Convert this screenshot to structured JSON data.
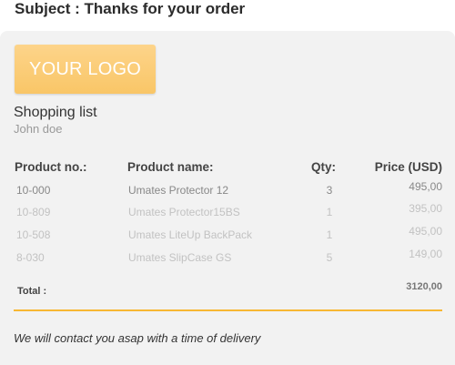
{
  "email": {
    "subject": "Subject : Thanks for your order"
  },
  "logo": {
    "text": "YOUR LOGO"
  },
  "list": {
    "title": "Shopping list",
    "customer": "John doe"
  },
  "table": {
    "headers": {
      "product_no": "Product no.:",
      "product_name": "Product name:",
      "qty": "Qty:",
      "price": "Price (USD)"
    },
    "rows": [
      {
        "no": "10-000",
        "name": "Umates Protector 12",
        "qty": "3",
        "price": "495,00"
      },
      {
        "no": "10-809",
        "name": "Umates Protector15BS",
        "qty": "1",
        "price": "395,00"
      },
      {
        "no": "10-508",
        "name": "Umates LiteUp BackPack",
        "qty": "1",
        "price": "495,00"
      },
      {
        "no": "8-030",
        "name": "Umates SlipCase GS",
        "qty": "5",
        "price": "149,00"
      }
    ],
    "total_label": "Total :",
    "total_value": "3120,00"
  },
  "footer": {
    "note": "We will contact you asap with a time of delivery"
  },
  "colors": {
    "accent": "#f7b733",
    "logo": "#fdd48a",
    "card_background": "#f2f2f2"
  }
}
